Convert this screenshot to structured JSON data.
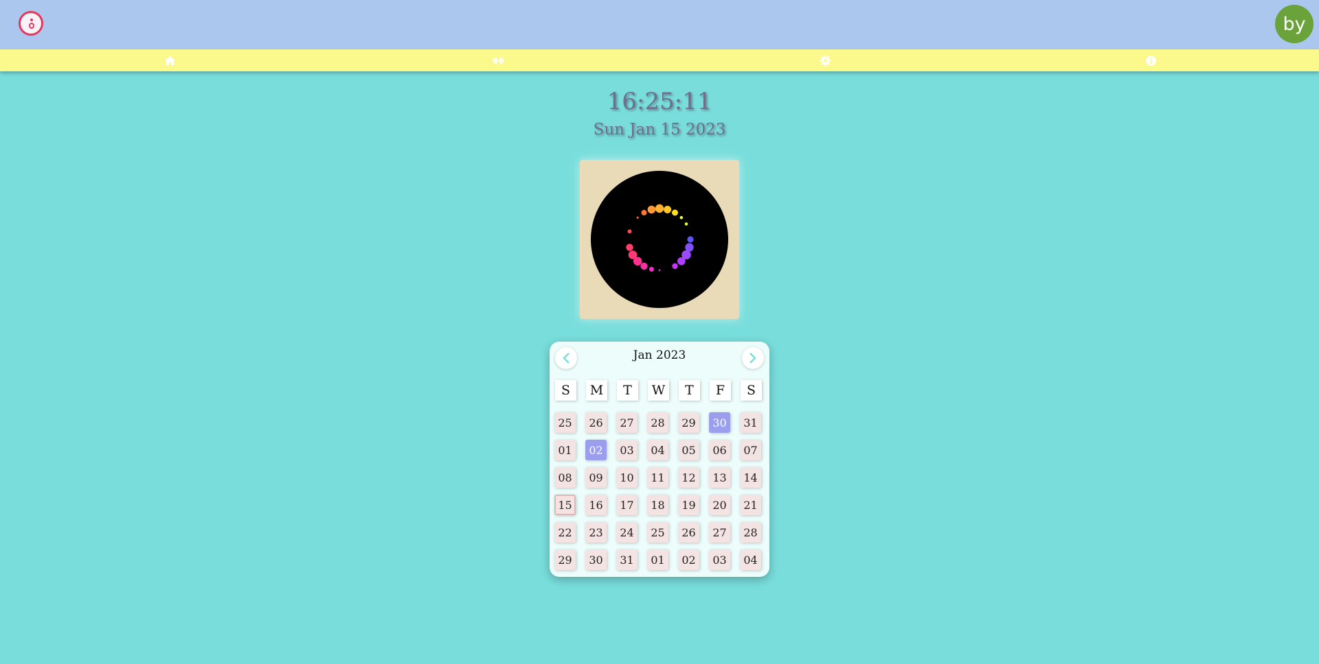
{
  "header": {
    "logo_icon": "app-logo-icon",
    "avatar_text": "by",
    "avatar_color": "#6aa33a"
  },
  "nav": {
    "items": [
      {
        "icon": "home-icon"
      },
      {
        "icon": "dumbbell-icon"
      },
      {
        "icon": "gear-icon"
      },
      {
        "icon": "info-icon"
      }
    ]
  },
  "clock": {
    "time": "16:25:11",
    "date": "Sun Jan 15 2023"
  },
  "artwork": {
    "description_icon": "dot-ring-animation"
  },
  "calendar": {
    "title": "Jan 2023",
    "prev_icon": "chevron-left-icon",
    "next_icon": "chevron-right-icon",
    "weekdays": [
      "S",
      "M",
      "T",
      "W",
      "T",
      "F",
      "S"
    ],
    "weeks": [
      [
        "25",
        "26",
        "27",
        "28",
        "29",
        "30",
        "31"
      ],
      [
        "01",
        "02",
        "03",
        "04",
        "05",
        "06",
        "07"
      ],
      [
        "08",
        "09",
        "10",
        "11",
        "12",
        "13",
        "14"
      ],
      [
        "15",
        "16",
        "17",
        "18",
        "19",
        "20",
        "21"
      ],
      [
        "22",
        "23",
        "24",
        "25",
        "26",
        "27",
        "28"
      ],
      [
        "29",
        "30",
        "31",
        "01",
        "02",
        "03",
        "04"
      ]
    ],
    "highlighted": [
      {
        "week": 0,
        "day": 5,
        "color": "#9b9eed"
      },
      {
        "week": 1,
        "day": 1,
        "color": "#9b9eed"
      }
    ],
    "today": {
      "week": 3,
      "day": 0
    }
  },
  "colors": {
    "background": "#79dedb",
    "topbar": "#abc7ee",
    "navbar": "#fbf88c",
    "accent": "#e8365a"
  }
}
